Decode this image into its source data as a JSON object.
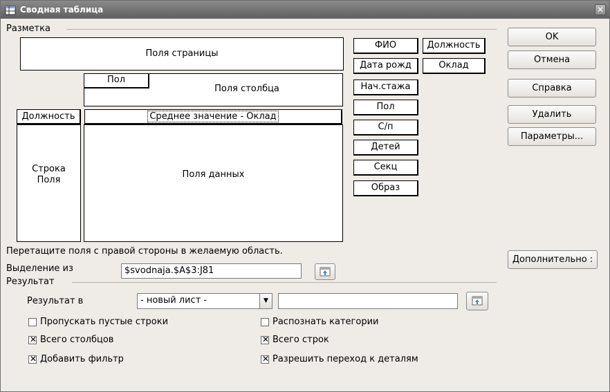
{
  "window": {
    "title": "Сводная таблица",
    "close_glyph": "✕"
  },
  "layout": {
    "section_label": "Разметка",
    "page_fields_label": "Поля страницы",
    "column_fields_label": "Поля столбца",
    "column_field_chip": "Пол",
    "row_field_chip": "Должность",
    "data_field_chip": "Среднее значение - Оклад",
    "row_fields_label_1": "Строка",
    "row_fields_label_2": "Поля",
    "data_fields_label": "Поля данных"
  },
  "available_fields": [
    "ФИО",
    "Должность",
    "Дата рожд",
    "Оклад",
    "Нач.стажа",
    "Пол",
    "С/п",
    "Детей",
    "Секц",
    "Образ"
  ],
  "hint": "Перетащите поля с правой стороны в желаемую область.",
  "selection": {
    "label": "Выделение из",
    "value": "$svodnaja.$A$3:J81"
  },
  "result": {
    "section_label": "Результат",
    "target_label": "Результат в",
    "target_option": "- новый лист -",
    "target_value": ""
  },
  "options": {
    "skip_empty_rows": "Пропускать пустые строки",
    "identify_categories": "Распознать категории",
    "total_columns": "Всего столбцов",
    "total_rows": "Всего строк",
    "add_filter": "Добавить фильтр",
    "enable_drilldown": "Разрешить переход к деталям"
  },
  "buttons": {
    "ok": "OK",
    "cancel": "Отмена",
    "help": "Справка",
    "delete": "Удалить",
    "parameters": "Параметры...",
    "more": "Дополнительно :"
  }
}
